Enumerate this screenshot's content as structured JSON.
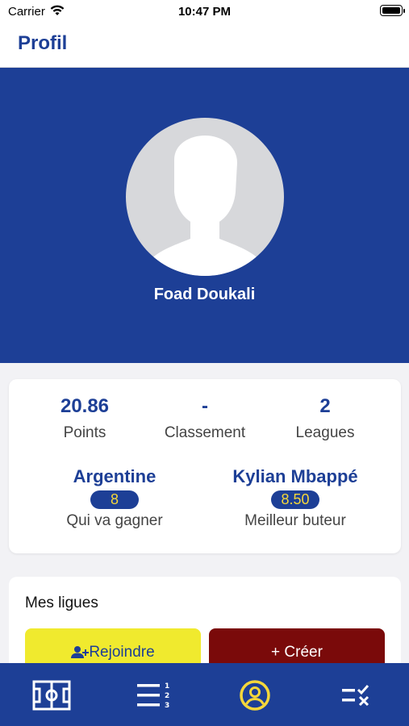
{
  "status_bar": {
    "carrier": "Carrier",
    "time": "10:47 PM"
  },
  "nav": {
    "title": "Profil"
  },
  "profile": {
    "name": "Foad Doukali"
  },
  "stats": {
    "points": {
      "value": "20.86",
      "label": "Points"
    },
    "ranking": {
      "value": "-",
      "label": "Classement"
    },
    "leagues": {
      "value": "2",
      "label": "Leagues"
    }
  },
  "predictions": {
    "winner": {
      "name": "Argentine",
      "score": "8",
      "label": "Qui va gagner"
    },
    "top_scorer": {
      "name": "Kylian Mbappé",
      "score": "8.50",
      "label": "Meilleur buteur"
    }
  },
  "leagues_section": {
    "title": "Mes ligues",
    "join_label": "Rejoindre",
    "create_label": "+ Créer"
  },
  "tab_bar": {
    "items": [
      "field-icon",
      "ranking-list-icon",
      "profile-icon",
      "predictions-icon"
    ],
    "active": "profile-icon",
    "active_color": "#f5d73a",
    "inactive_color": "#ffffff"
  },
  "colors": {
    "primary": "#1d3f96",
    "accent": "#f5d73a",
    "join_button": "#f0ea2e",
    "create_button": "#7a0a0a"
  }
}
